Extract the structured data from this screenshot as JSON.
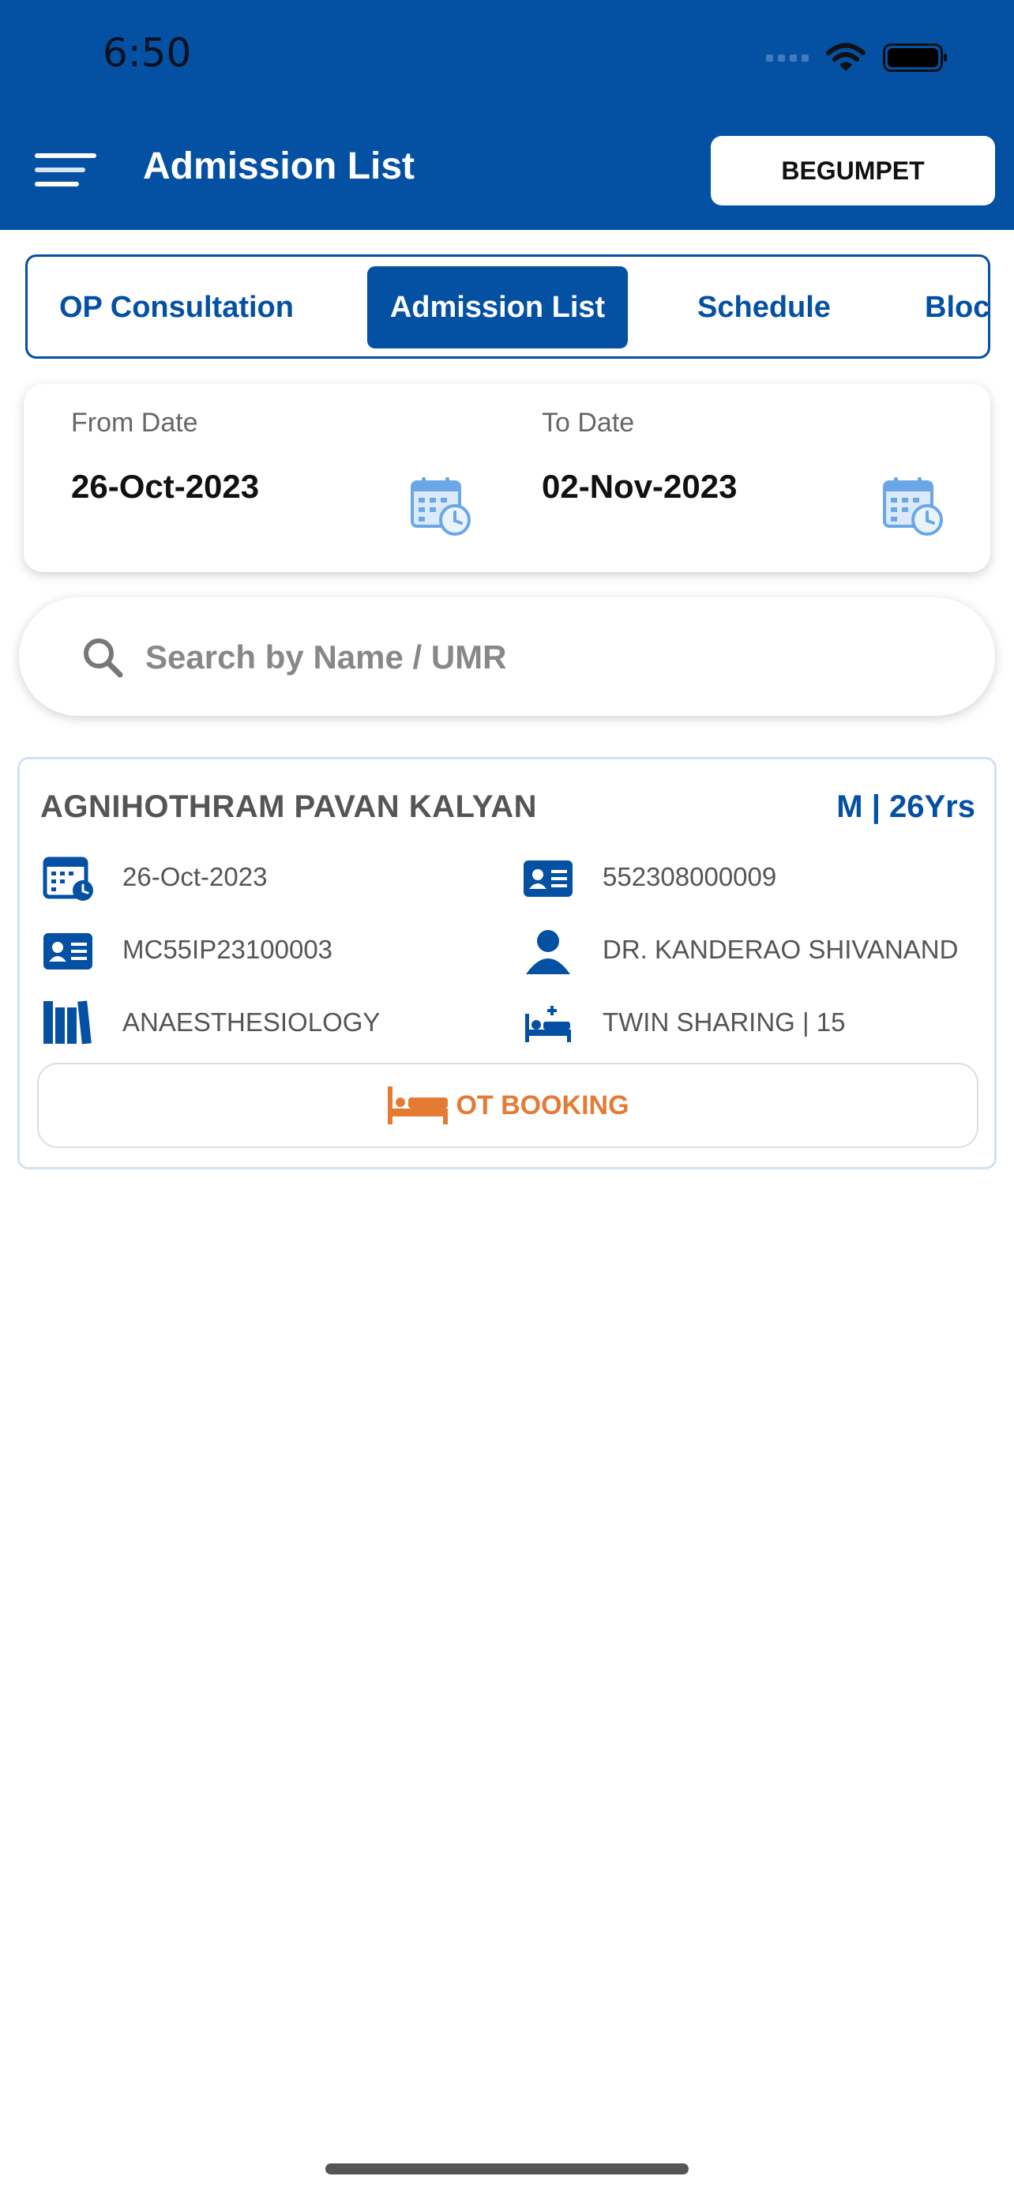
{
  "status_bar": {
    "time": "6:50"
  },
  "header": {
    "title": "Admission List",
    "branch": "BEGUMPET"
  },
  "tabs": [
    {
      "label": "OP Consultation",
      "active": false
    },
    {
      "label": "Admission List",
      "active": true
    },
    {
      "label": "Schedule",
      "active": false
    },
    {
      "label": "Bloc",
      "active": false
    }
  ],
  "dates": {
    "from_label": "From Date",
    "from_value": "26-Oct-2023",
    "to_label": "To Date",
    "to_value": "02-Nov-2023"
  },
  "search": {
    "placeholder": "Search by Name / UMR",
    "value": ""
  },
  "patients": [
    {
      "name": "AGNIHOTHRAM PAVAN KALYAN",
      "gender_age": "M | 26Yrs",
      "admission_date": "26-Oct-2023",
      "umr": "552308000009",
      "ip_number": "MC55IP23100003",
      "doctor": "DR. KANDERAO SHIVANAND",
      "department": "ANAESTHESIOLOGY",
      "room": "TWIN SHARING | 15",
      "action_label": "OT BOOKING"
    }
  ],
  "colors": {
    "primary": "#0450a3",
    "accent": "#e57a33",
    "calendar_icon": "#6ba6e6"
  },
  "icons": [
    "menu-icon",
    "calendar-icon",
    "search-icon",
    "calendar-clock-icon",
    "id-card-icon",
    "person-icon",
    "books-icon",
    "bed-icon",
    "ot-bed-icon",
    "wifi-icon",
    "battery-icon"
  ]
}
